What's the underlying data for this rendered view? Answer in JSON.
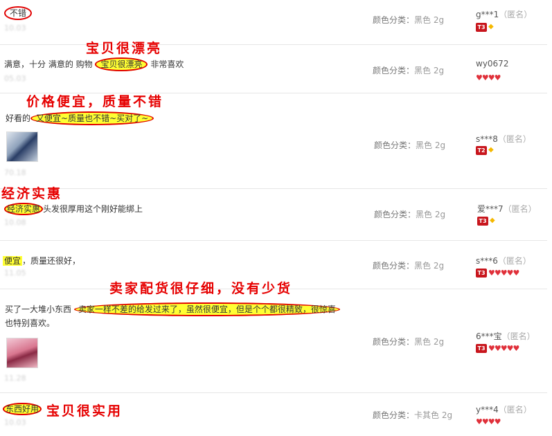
{
  "reviews": [
    {
      "content": "不错",
      "sku_label": "颜色分类：",
      "sku_value": "黑色 2g",
      "user": "g***1",
      "anon": "（匿名）",
      "level": "T3"
    },
    {
      "content_pre": "满意，十分 满意的 购物",
      "content_hl": "宝贝很漂亮",
      "content_post": "非常喜欢",
      "sku_label": "颜色分类：",
      "sku_value": "黑色 2g",
      "user": "wy0672"
    },
    {
      "content_pre": "好看的",
      "content_hl": "又便宜~质量也不错~买对了~",
      "sku_label": "颜色分类：",
      "sku_value": "黑色 2g",
      "user": "s***8",
      "anon": "（匿名）",
      "level": "T2"
    },
    {
      "content_hl": "经济实惠",
      "content_post": "头发很厚用这个刚好能绑上",
      "sku_label": "颜色分类：",
      "sku_value": "黑色 2g",
      "user": "爱***7",
      "anon": "（匿名）",
      "level": "T3"
    },
    {
      "content_hl": "便宜",
      "content_post": "，质量还很好，",
      "sku_label": "颜色分类：",
      "sku_value": "黑色 2g",
      "user": "s***6",
      "anon": "（匿名）",
      "level": "T3"
    },
    {
      "content_pre": "买了一大堆小东西",
      "content_hl": "卖家一样不差的给发过来了，虽然很便宜，但是个个都很精致，很惊喜",
      "content_line2": "也特别喜欢。",
      "sku_label": "颜色分类：",
      "sku_value": "黑色 2g",
      "user": "6***宝",
      "anon": "（匿名）",
      "level": "T3"
    },
    {
      "content_hl": "东西好用",
      "sku_label": "颜色分类：",
      "sku_value": "卡其色 2g",
      "user": "y***4",
      "anon": "（匿名）"
    }
  ],
  "annotations": {
    "a1": "宝贝很漂亮",
    "a2": "价格便宜，质量不错",
    "a3": "经济实惠",
    "a4": "卖家配货很仔细，没有少货",
    "a5": "宝贝很实用"
  },
  "icons": {
    "level_badge": "red-level-badge",
    "diamond": "yellow-diamond-icon",
    "heart": "red-heart-icon"
  }
}
